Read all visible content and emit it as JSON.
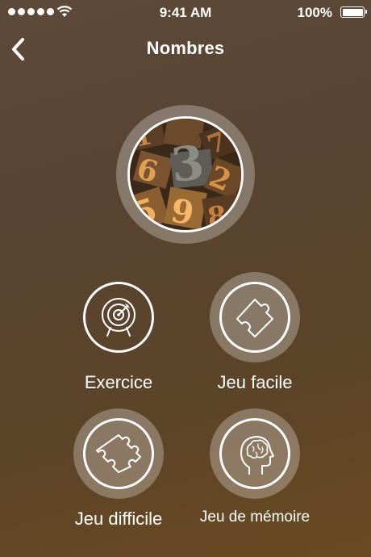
{
  "status_bar": {
    "time": "9:41 AM",
    "battery": "100%"
  },
  "nav": {
    "title": "Nombres",
    "back_icon": "chevron-left-icon"
  },
  "hero": {
    "image": "wooden-letterpress-numbers"
  },
  "options": [
    {
      "label": "Exercice",
      "icon": "target-icon",
      "highlighted": false
    },
    {
      "label": "Jeu facile",
      "icon": "puzzle-piece-icon",
      "highlighted": true
    },
    {
      "label": "Jeu difficile",
      "icon": "puzzle-piece-icon",
      "highlighted": true
    },
    {
      "label": "Jeu de mémoire",
      "icon": "brain-head-icon",
      "highlighted": true
    }
  ],
  "colors": {
    "background": "#5a4530",
    "foreground": "#ffffff"
  }
}
